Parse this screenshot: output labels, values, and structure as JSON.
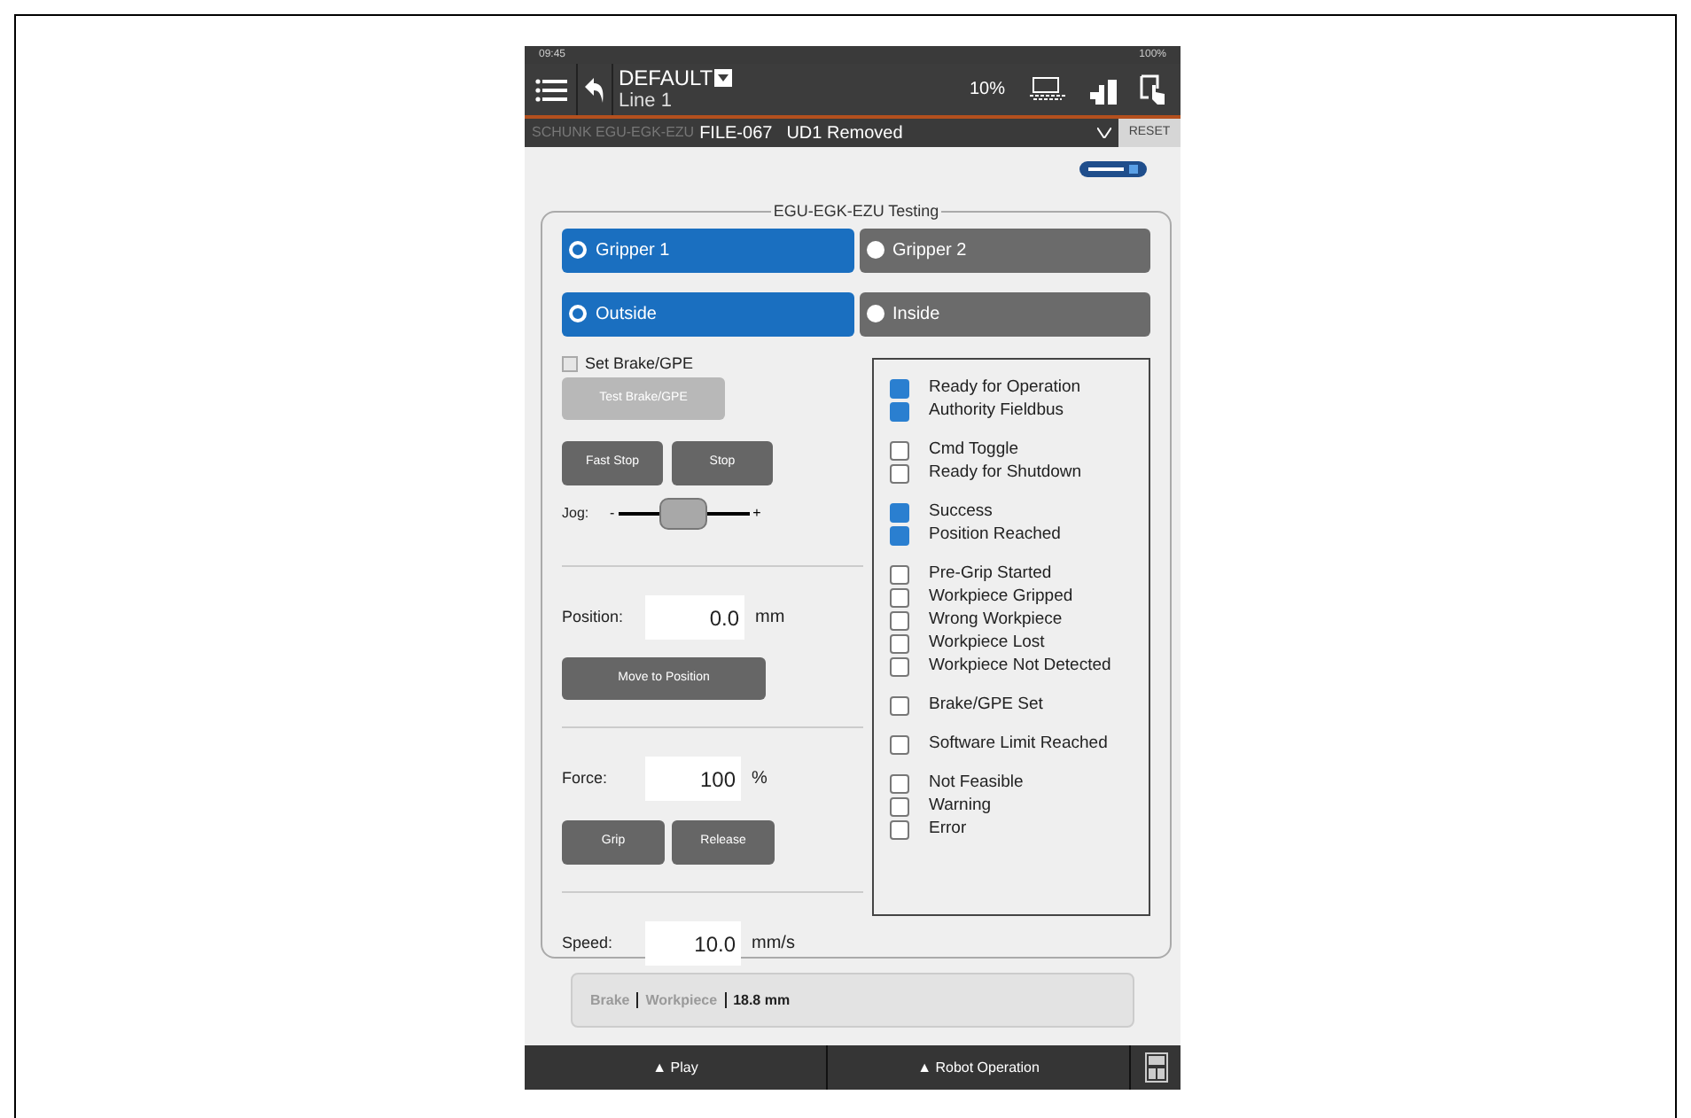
{
  "status_bar": {
    "time": "09:45",
    "battery": "100%"
  },
  "header": {
    "title": "DEFAULT",
    "subtitle": "Line 1",
    "speed": "10%"
  },
  "program_bar": {
    "device": "SCHUNK EGU-EGK-EZU",
    "file": "FILE-067",
    "message": "UD1 Removed",
    "reset": "RESET"
  },
  "panel": {
    "legend": "EGU-EGK-EZU Testing",
    "gripper_options": [
      {
        "label": "Gripper 1",
        "selected": true
      },
      {
        "label": "Gripper 2",
        "selected": false
      }
    ],
    "direction_options": [
      {
        "label": "Outside",
        "selected": true
      },
      {
        "label": "Inside",
        "selected": false
      }
    ],
    "set_brake": {
      "label": "Set Brake/GPE",
      "checked": false
    },
    "test_brake_button": {
      "label": "Test Brake/GPE",
      "disabled": true
    },
    "stop_buttons": [
      "Fast Stop",
      "Stop"
    ],
    "jog": {
      "label": "Jog:",
      "minus": "-",
      "plus": "+",
      "level": 0.5
    },
    "position": {
      "label": "Position:",
      "value": "0.0",
      "unit": "mm",
      "button": "Move to Position"
    },
    "force": {
      "label": "Force:",
      "value": "100",
      "unit": "%",
      "buttons": [
        "Grip",
        "Release"
      ]
    },
    "speed": {
      "label": "Speed:",
      "value": "10.0",
      "unit": "mm/s"
    },
    "status_groups": [
      [
        {
          "label": "Ready for Operation",
          "checked": true
        },
        {
          "label": "Authority Fieldbus",
          "checked": true
        }
      ],
      [
        {
          "label": "Cmd Toggle",
          "checked": false
        },
        {
          "label": "Ready for Shutdown",
          "checked": false
        }
      ],
      [
        {
          "label": "Success",
          "checked": true
        },
        {
          "label": "Position Reached",
          "checked": true
        }
      ],
      [
        {
          "label": "Pre-Grip Started",
          "checked": false
        },
        {
          "label": "Workpiece Gripped",
          "checked": false
        },
        {
          "label": "Wrong Workpiece",
          "checked": false
        },
        {
          "label": "Workpiece Lost",
          "checked": false
        },
        {
          "label": "Workpiece Not Detected",
          "checked": false
        }
      ],
      [
        {
          "label": "Brake/GPE Set",
          "checked": false
        }
      ],
      [
        {
          "label": "Software Limit Reached",
          "checked": false
        }
      ],
      [
        {
          "label": "Not Feasible",
          "checked": false
        },
        {
          "label": "Warning",
          "checked": false
        },
        {
          "label": "Error",
          "checked": false
        }
      ]
    ]
  },
  "info_bar": {
    "items": [
      {
        "label": "Brake",
        "active": false
      },
      {
        "label": "Workpiece",
        "active": false
      },
      {
        "label": "18.8 mm",
        "active": true
      }
    ]
  },
  "bottom_nav": [
    "Play",
    "Robot Operation"
  ],
  "bottom_nav_marker": "▲"
}
